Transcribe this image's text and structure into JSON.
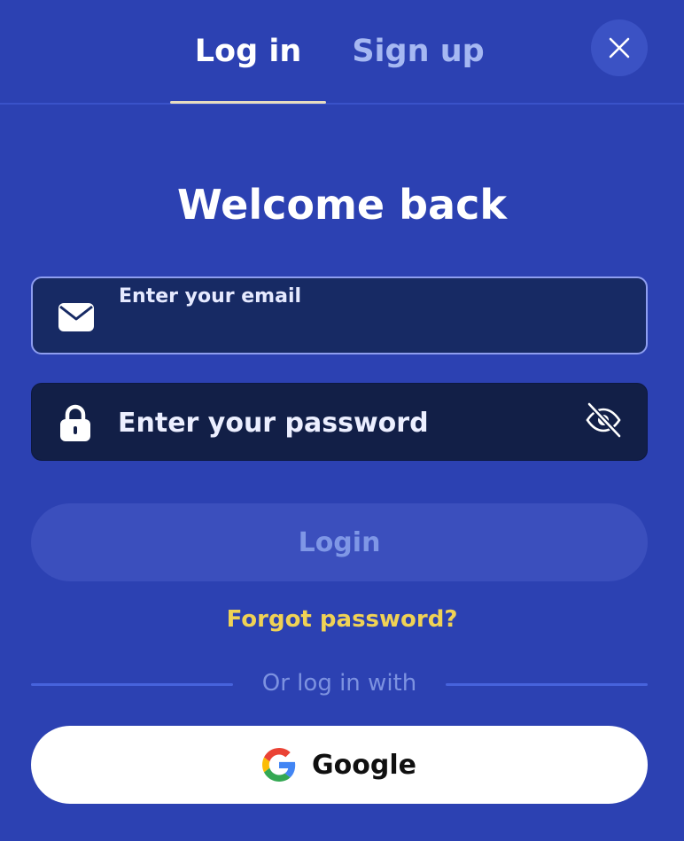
{
  "tabs": {
    "login_label": "Log in",
    "signup_label": "Sign up"
  },
  "title": "Welcome back",
  "email_field": {
    "label": "Enter your email",
    "value": ""
  },
  "password_field": {
    "placeholder": "Enter your password",
    "value": ""
  },
  "login_button_label": "Login",
  "forgot_password_label": "Forgot password?",
  "divider_text": "Or log in with",
  "google_button_label": "Google",
  "icons": {
    "close": "close-icon",
    "email": "envelope-icon",
    "password": "lock-icon",
    "visibility": "eye-slash-icon",
    "google": "google-logo-icon"
  },
  "colors": {
    "background": "#2c41b2",
    "accent_yellow": "#f0d255",
    "field_bg": "#172a64",
    "login_button_bg": "#3b4fbd"
  }
}
